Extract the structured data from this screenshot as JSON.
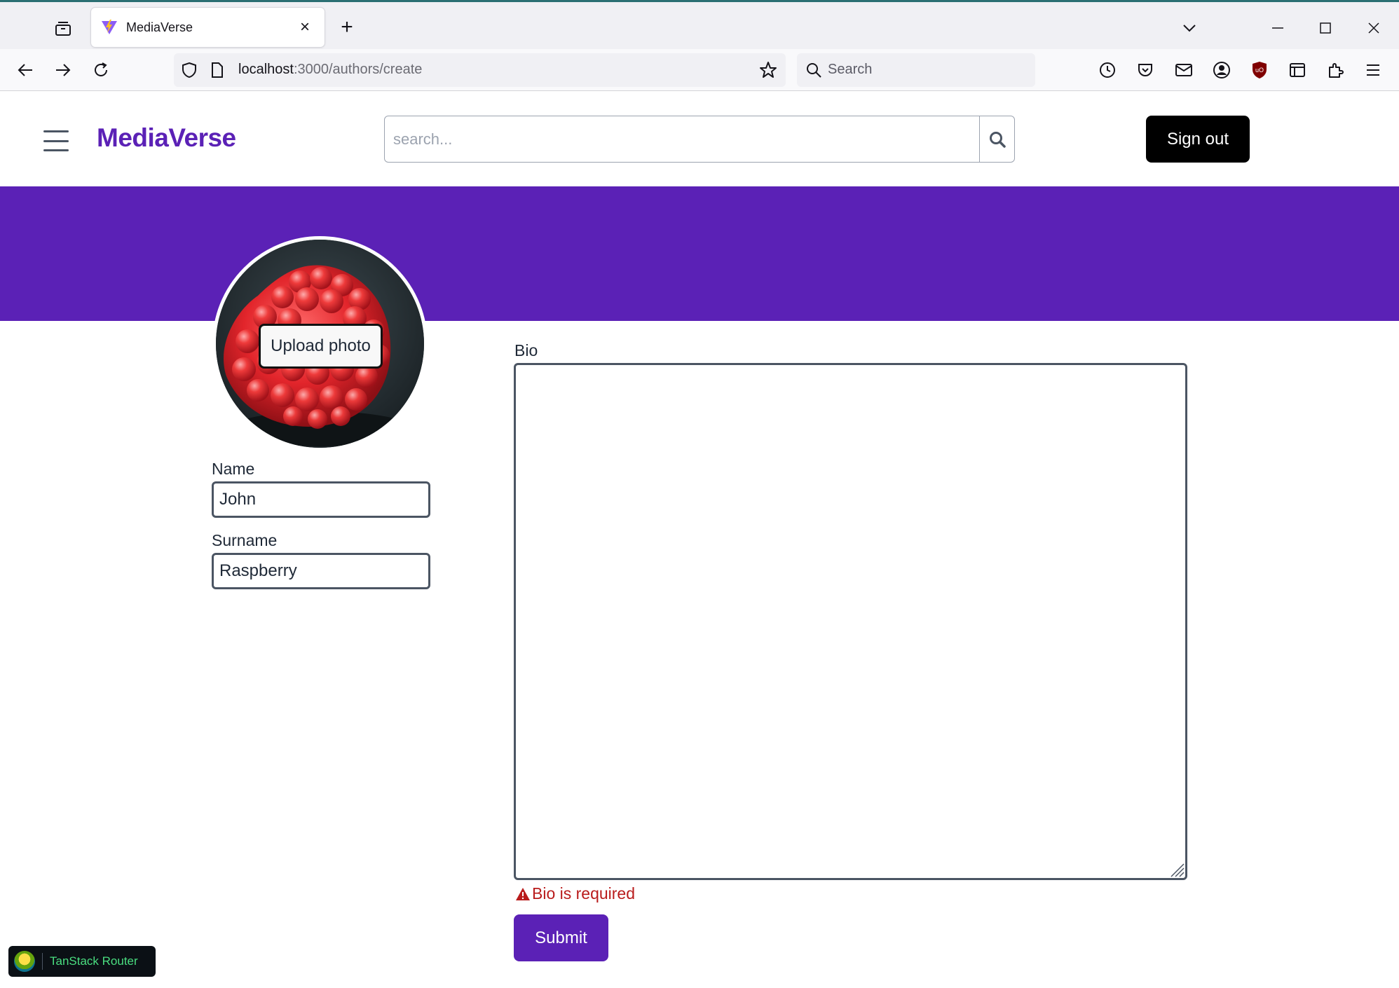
{
  "browser": {
    "tab_title": "MediaVerse",
    "url_host": "localhost",
    "url_path": ":3000/authors/create",
    "search_placeholder": "Search"
  },
  "header": {
    "brand": "MediaVerse",
    "search_placeholder": "search...",
    "signout_label": "Sign out"
  },
  "form": {
    "upload_label": "Upload photo",
    "name_label": "Name",
    "name_value": "John",
    "surname_label": "Surname",
    "surname_value": "Raspberry",
    "bio_label": "Bio",
    "bio_value": "",
    "bio_error": "Bio is required",
    "submit_label": "Submit"
  },
  "devtools": {
    "label": "TanStack Router"
  },
  "colors": {
    "brand": "#5b21b6",
    "error": "#b91c1c",
    "signout_bg": "#000000"
  },
  "icons": [
    "tab-list-icon",
    "close-icon",
    "plus-icon",
    "chevron-down-icon",
    "minimize-icon",
    "maximize-icon",
    "back-icon",
    "forward-icon",
    "reload-icon",
    "shield-icon",
    "page-icon",
    "star-icon",
    "search-icon",
    "history-icon",
    "pocket-icon",
    "mail-icon",
    "account-icon",
    "ublock-icon",
    "container-icon",
    "extensions-icon",
    "menu-icon",
    "hamburger-icon",
    "warning-icon"
  ]
}
